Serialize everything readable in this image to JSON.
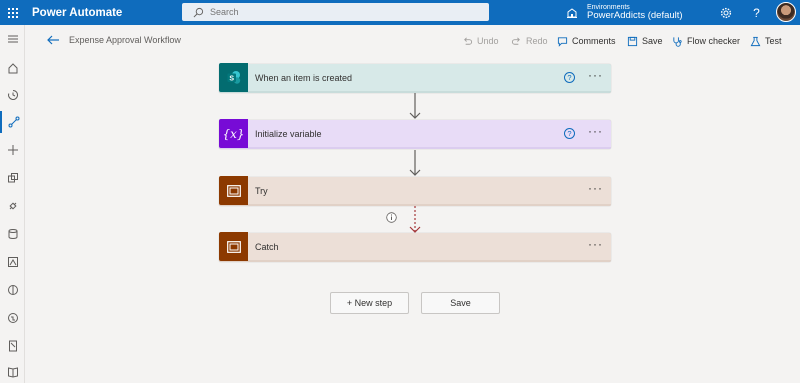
{
  "app": {
    "name": "Power Automate"
  },
  "search": {
    "placeholder": "Search"
  },
  "environment": {
    "label": "Environments",
    "value": "PowerAddicts (default)"
  },
  "flow": {
    "title": "Expense Approval Workflow"
  },
  "commands": {
    "undo": "Undo",
    "redo": "Redo",
    "comments": "Comments",
    "save": "Save",
    "flow_checker": "Flow checker",
    "test": "Test"
  },
  "steps": [
    {
      "title": "When an item is created",
      "icon": "sharepoint-icon"
    },
    {
      "title": "Initialize variable",
      "icon": "variable-icon",
      "icon_text": "{x}"
    },
    {
      "title": "Try",
      "icon": "scope-icon"
    },
    {
      "title": "Catch",
      "icon": "scope-icon"
    }
  ],
  "colors": {
    "brand": "#0f6cbd",
    "sharepoint": "#036c70",
    "variable": "#770bd6",
    "scope": "#8c3900"
  },
  "buttons": {
    "new_step": "+ New step",
    "save": "Save"
  },
  "rail_icons": [
    "hamburger-icon",
    "home-icon",
    "clock-icon",
    "flow-icon",
    "plus-icon",
    "templates-icon",
    "connectors-icon",
    "data-icon",
    "ai-icon",
    "process-icon",
    "solutions-icon",
    "mobile-icon",
    "learn-icon"
  ]
}
